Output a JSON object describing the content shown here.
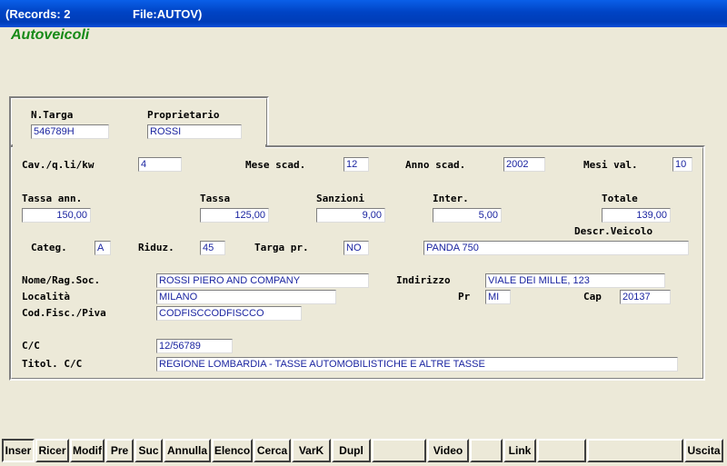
{
  "titlebar": {
    "records": "(Records: 2",
    "file": "File:AUTOV)"
  },
  "form": {
    "title": "Autoveicoli"
  },
  "top_section": {
    "targa": {
      "label": "N.Targa",
      "value": "546789H"
    },
    "proprietario": {
      "label": "Proprietario",
      "value": "ROSSI"
    }
  },
  "details": {
    "cav": {
      "label": "Cav./q.li/kw",
      "value": "4"
    },
    "mese_scad": {
      "label": "Mese scad.",
      "value": "12"
    },
    "anno_scad": {
      "label": "Anno scad.",
      "value": "2002"
    },
    "mesi_val": {
      "label": "Mesi val.",
      "value": "10"
    },
    "tassa_ann": {
      "label": "Tassa ann.",
      "value": "150,00"
    },
    "tassa": {
      "label": "Tassa",
      "value": "125,00"
    },
    "sanzioni": {
      "label": "Sanzioni",
      "value": "9,00"
    },
    "inter": {
      "label": "Inter.",
      "value": "5,00"
    },
    "totale": {
      "label": "Totale",
      "value": "139,00"
    },
    "descr_veicolo": {
      "label": "Descr.Veicolo",
      "value": "PANDA 750"
    },
    "categ": {
      "label": "Categ.",
      "value": "A"
    },
    "riduz": {
      "label": "Riduz.",
      "value": "45"
    },
    "targa_pr": {
      "label": "Targa pr.",
      "value": "NO"
    },
    "nome": {
      "label": "Nome/Rag.Soc.",
      "value": "ROSSI PIERO AND COMPANY"
    },
    "indirizzo": {
      "label": "Indirizzo",
      "value": "VIALE DEI MILLE, 123"
    },
    "localita": {
      "label": "Località",
      "value": "MILANO"
    },
    "pr": {
      "label": "Pr",
      "value": "MI"
    },
    "cap": {
      "label": "Cap",
      "value": "20137"
    },
    "codfisc": {
      "label": "Cod.Fisc./Piva",
      "value": "CODFISCCODFISCCO"
    },
    "cc": {
      "label": "C/C",
      "value": "12/56789"
    },
    "titol_cc": {
      "label": "Titol. C/C",
      "value": "REGIONE LOMBARDIA  -  TASSE AUTOMOBILISTICHE E ALTRE TASSE"
    }
  },
  "toolbar": {
    "inser": "Inser",
    "ricer": "Ricer",
    "modif": "Modif",
    "pre": "Pre",
    "suc": "Suc",
    "annulla": "Annulla",
    "elenco": "Elenco",
    "cerca": "Cerca",
    "vark": "VarK",
    "dupl": "Dupl",
    "video": "Video",
    "link": "Link",
    "uscita": "Uscita"
  },
  "colors": {
    "title_green": "#168a16",
    "field_text": "#1a24a0",
    "titlebar_blue": "#0043c4"
  }
}
